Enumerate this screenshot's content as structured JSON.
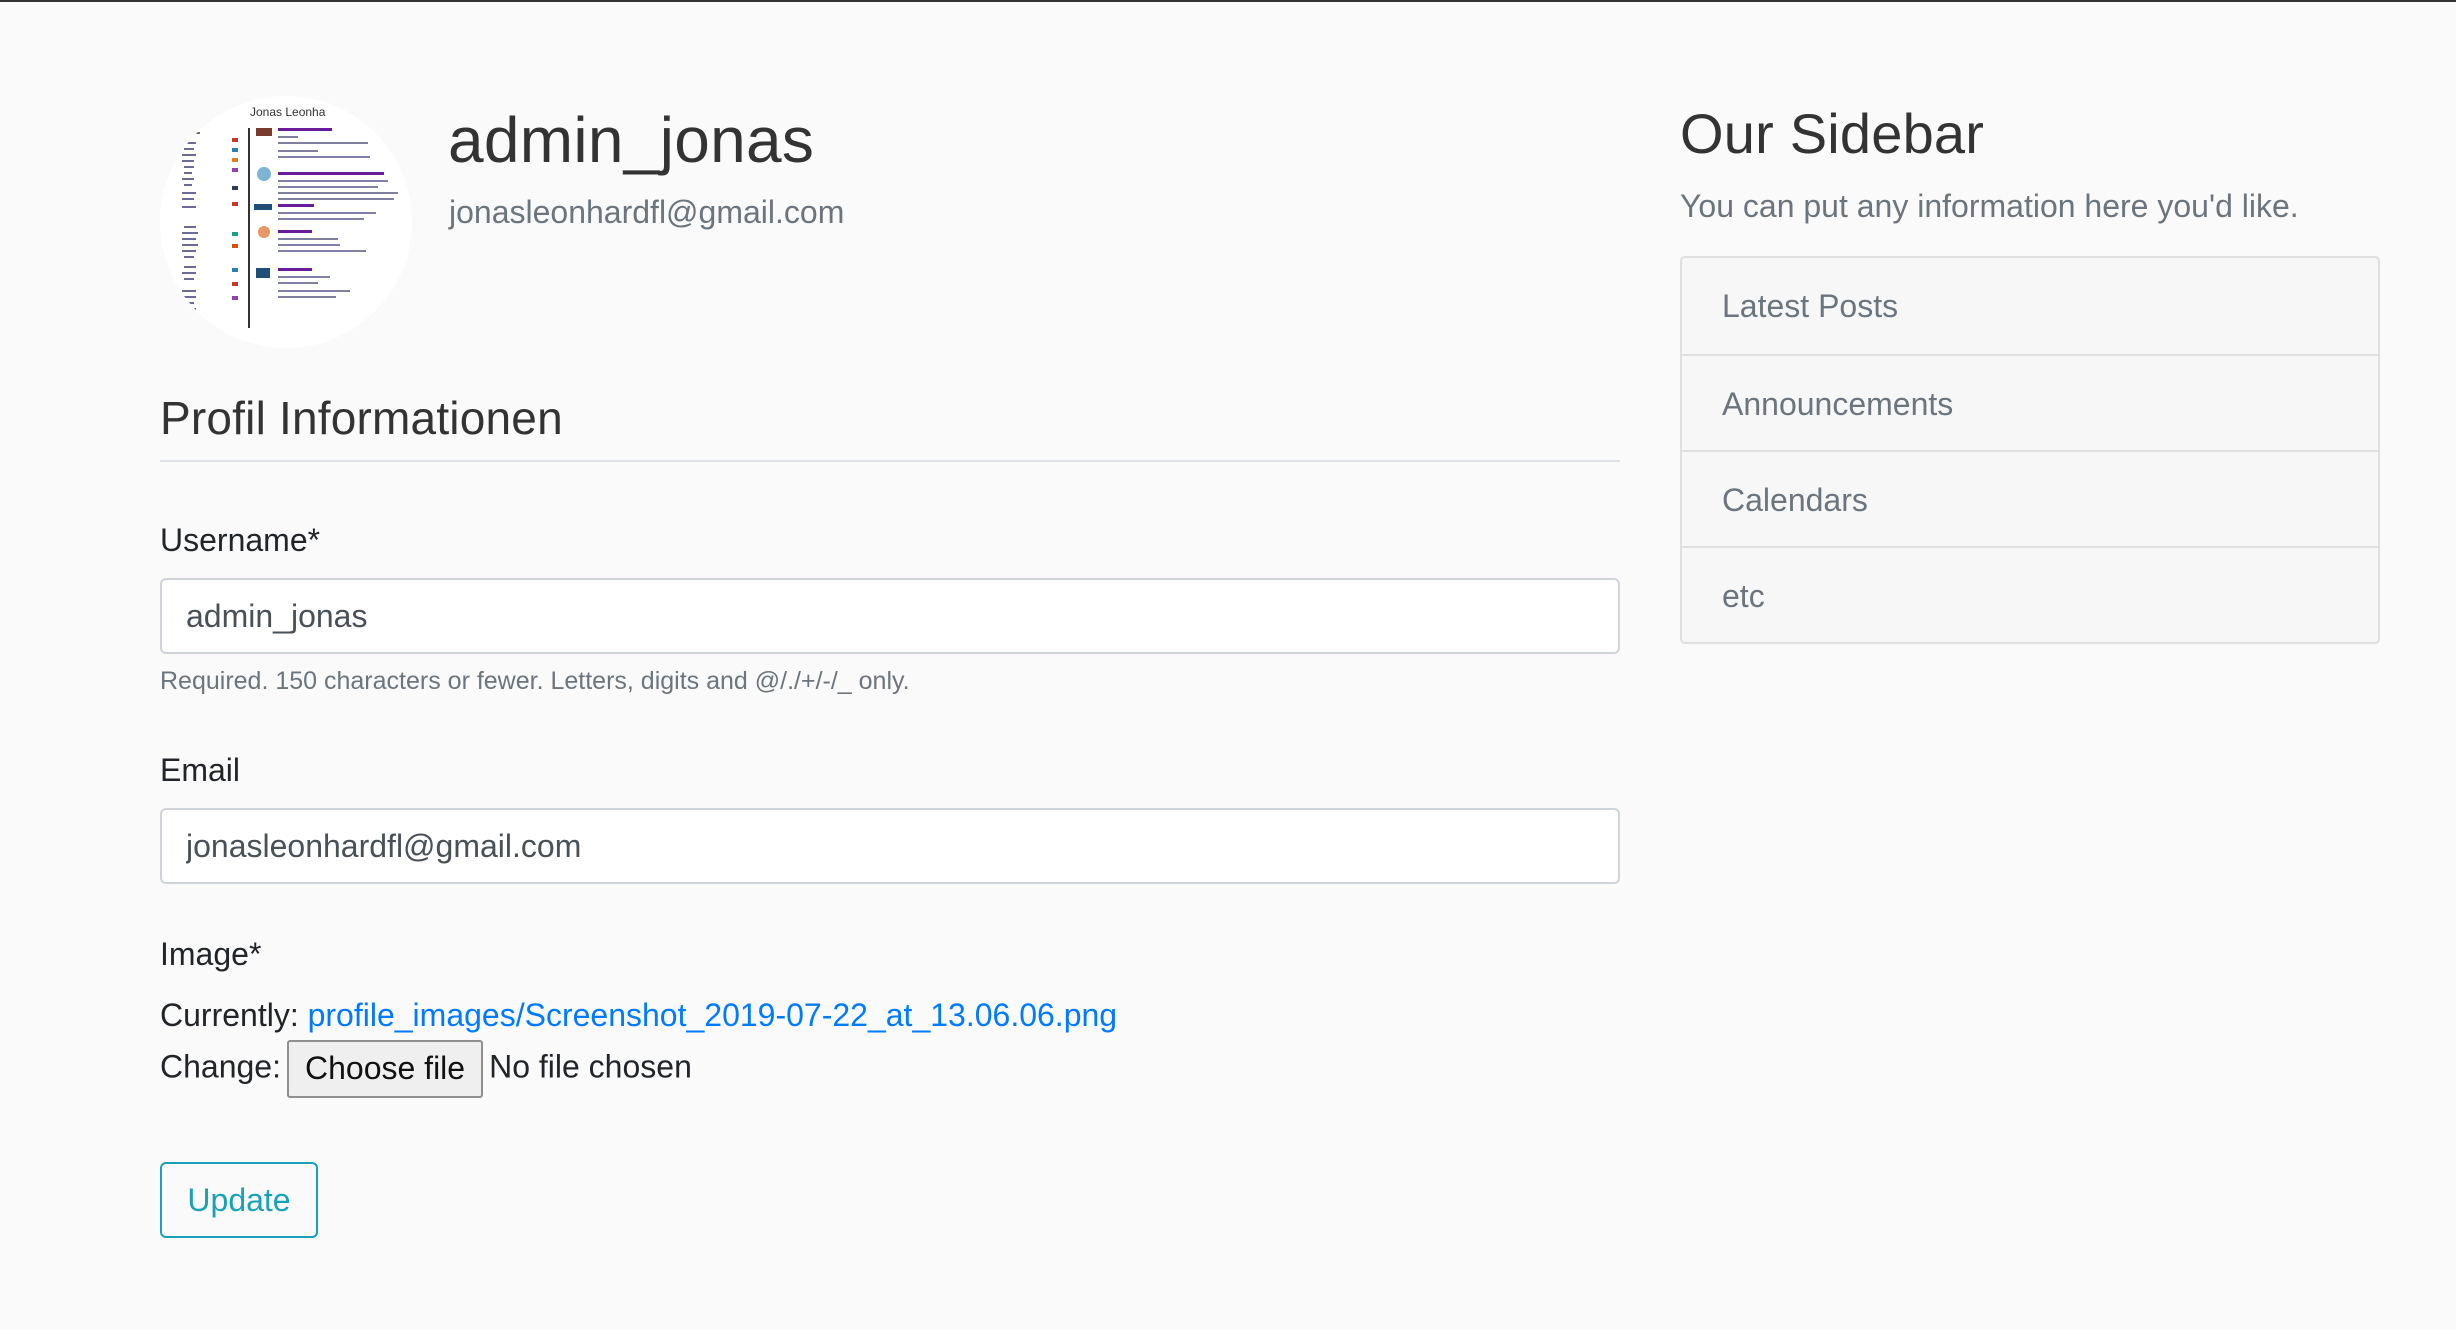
{
  "profile": {
    "username": "admin_jonas",
    "email": "jonasleonhardfl@gmail.com",
    "avatar_heading": "Jonas Leonha"
  },
  "form": {
    "legend": "Profil Informationen",
    "username_label": "Username*",
    "username_value": "admin_jonas",
    "username_help": "Required. 150 characters or fewer. Letters, digits and @/./+/-/_ only.",
    "email_label": "Email",
    "email_value": "jonasleonhardfl@gmail.com",
    "image_label": "Image*",
    "currently_label": "Currently:",
    "current_image": "profile_images/Screenshot_2019-07-22_at_13.06.06.png",
    "change_label": "Change:",
    "choose_file_label": "Choose file",
    "no_file_text": "No file chosen",
    "update_label": "Update"
  },
  "sidebar": {
    "title": "Our Sidebar",
    "subtitle": "You can put any information here you'd like.",
    "items": [
      {
        "label": "Latest Posts"
      },
      {
        "label": "Announcements"
      },
      {
        "label": "Calendars"
      },
      {
        "label": "etc"
      }
    ]
  },
  "colors": {
    "link": "#007bff",
    "update_accent": "#17a2b8",
    "muted": "#6c757d"
  }
}
